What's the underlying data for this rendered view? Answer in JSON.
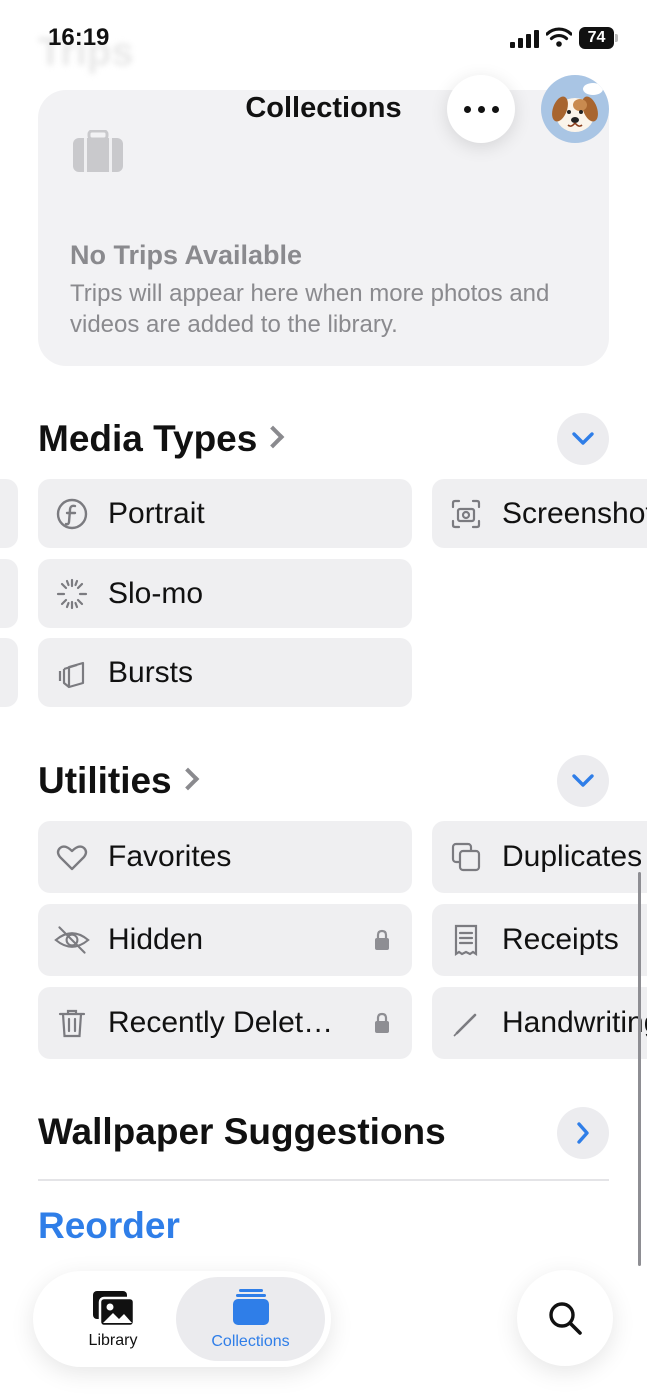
{
  "status_bar": {
    "time": "16:19",
    "battery": "74"
  },
  "header": {
    "ghost_title": "Trips",
    "title": "Collections"
  },
  "trips_card": {
    "title": "No Trips Available",
    "subtitle": "Trips will appear here when more photos and videos are added to the library."
  },
  "media_types": {
    "title": "Media Types",
    "items": [
      {
        "label": "Portrait",
        "icon": "portrait-f-icon"
      },
      {
        "label": "Slo-mo",
        "icon": "slomo-icon"
      },
      {
        "label": "Bursts",
        "icon": "bursts-icon"
      },
      {
        "label": "Screenshots",
        "icon": "screenshot-icon"
      }
    ]
  },
  "utilities": {
    "title": "Utilities",
    "items": [
      {
        "label": "Favorites",
        "icon": "heart-icon"
      },
      {
        "label": "Hidden",
        "icon": "eye-slash-icon",
        "locked": true
      },
      {
        "label": "Recently Delet…",
        "icon": "trash-icon",
        "locked": true
      },
      {
        "label": "Duplicates",
        "icon": "duplicate-icon"
      },
      {
        "label": "Receipts",
        "icon": "receipt-icon"
      },
      {
        "label": "Handwriting",
        "icon": "pencil-icon"
      }
    ]
  },
  "wallpaper": {
    "title": "Wallpaper Suggestions"
  },
  "reorder": {
    "label": "Reorder"
  },
  "tab_bar": {
    "tabs": [
      {
        "label": "Library",
        "selected": false
      },
      {
        "label": "Collections",
        "selected": true
      }
    ]
  },
  "colors": {
    "accent": "#2f7ee8",
    "tile_bg": "#efeff1",
    "secondary_text": "#8a8a8e"
  }
}
